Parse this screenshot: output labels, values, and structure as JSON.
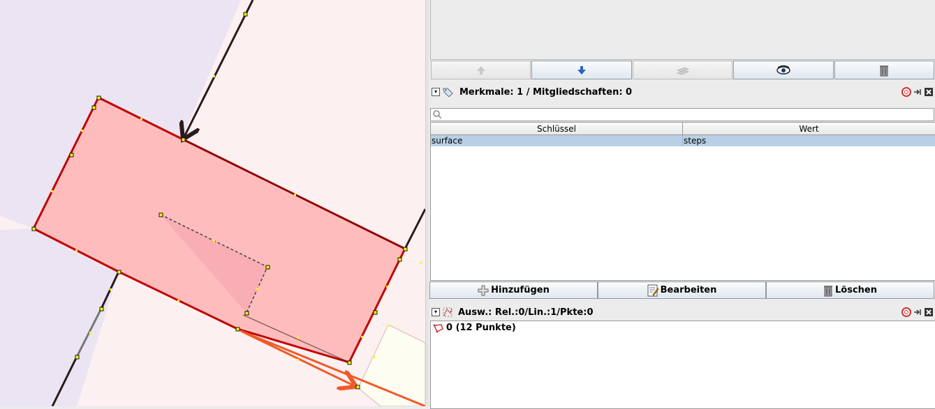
{
  "map": {
    "colors": {
      "background": "#fdf0f1",
      "left_area": "#ebe4f2",
      "selected_area_fill": "#ffbcbd",
      "selected_way": "#c00000",
      "way": "#2a1a1a",
      "orange_way": "#f05a28",
      "nearby_area": "#fdfdf2"
    }
  },
  "toolbar": {
    "buttons": [
      {
        "icon": "move-up-icon",
        "enabled": false
      },
      {
        "icon": "move-down-icon",
        "enabled": true
      },
      {
        "icon": "layers-icon",
        "enabled": false
      },
      {
        "icon": "eye-icon",
        "enabled": true
      },
      {
        "icon": "trash-icon",
        "enabled": true
      }
    ]
  },
  "tags_panel": {
    "title": "Merkmale: 1 / Mitgliedschaften: 0",
    "search_placeholder": "",
    "columns": [
      "Schlüssel",
      "Wert"
    ],
    "rows": [
      {
        "key": "surface",
        "value": "steps"
      }
    ],
    "buttons": {
      "add": "Hinzufügen",
      "edit": "Bearbeiten",
      "delete": "Löschen"
    }
  },
  "selection_panel": {
    "title": "Ausw.: Rel.:0/Lin.:1/Pkte:0",
    "items": [
      {
        "label": "0 (12 Punkte)",
        "icon": "way-icon"
      }
    ]
  }
}
